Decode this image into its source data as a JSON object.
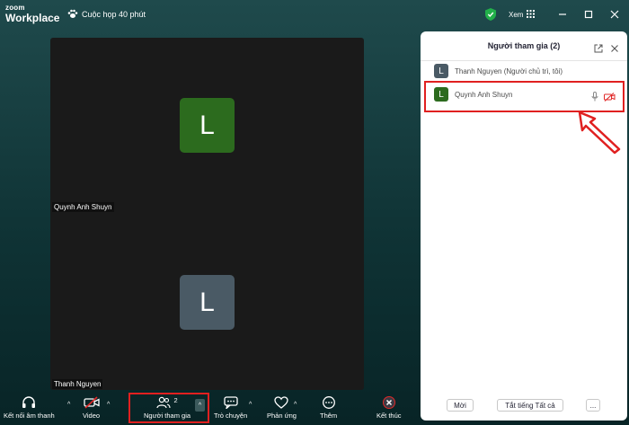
{
  "app": {
    "logo_top": "zoom",
    "logo_bottom": "Workplace"
  },
  "meeting": {
    "title": "Cuộc họp 40 phút"
  },
  "header": {
    "view_label": "Xem"
  },
  "gallery": {
    "tiles": [
      {
        "initial": "L",
        "name": "Quynh Anh Shuyn",
        "color": "#2c6b1e"
      },
      {
        "initial": "L",
        "name": "Thanh Nguyen",
        "color": "#4a5a65"
      }
    ]
  },
  "participants_panel": {
    "title": "Người tham gia (2)",
    "participants": [
      {
        "initial": "L",
        "name": "Thanh Nguyen (Người chủ trì, tôi)",
        "color": "#4a5a65"
      },
      {
        "initial": "L",
        "name": "Quynh Anh Shuyn",
        "color": "#2c6b1e"
      }
    ],
    "invite_label": "Mời",
    "mute_all_label": "Tắt tiếng Tất cả",
    "more_label": "..."
  },
  "toolbar": {
    "audio_label": "Kết nối âm thanh",
    "video_label": "Video",
    "participants_label": "Người tham gia",
    "participants_count": "2",
    "chat_label": "Trò chuyện",
    "reactions_label": "Phản ứng",
    "more_label": "Thêm",
    "end_label": "Kết thúc"
  },
  "colors": {
    "accent_highlight": "#e02020",
    "shield_green": "#22b04a",
    "end_red": "#e02828"
  }
}
